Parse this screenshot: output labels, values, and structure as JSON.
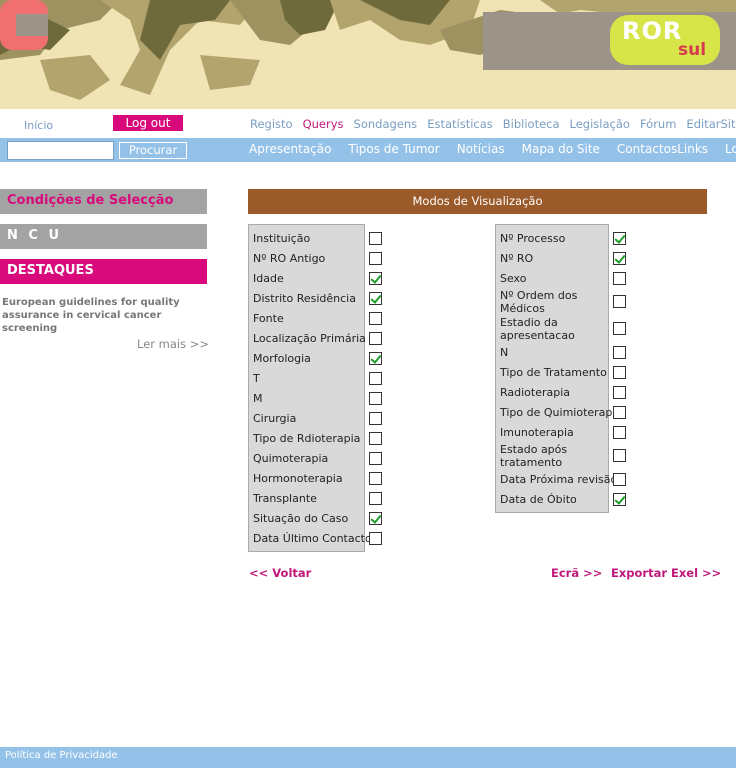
{
  "banner": {
    "logo_ror": "ROR",
    "logo_sul": "sul",
    "colors": {
      "sand": "#f1e4b4",
      "camo_dark": "#6e6a3c",
      "camo_mid": "#b3a46e",
      "logo_box": "#9c9488",
      "ror_bg": "#d8e548",
      "c_red": "#f07070"
    }
  },
  "topnav": {
    "inicio": "Início",
    "logout": "Log out",
    "items": [
      {
        "label": "Registo",
        "active": false
      },
      {
        "label": "Querys",
        "active": true
      },
      {
        "label": "Sondagens",
        "active": false
      },
      {
        "label": "Estatísticas",
        "active": false
      },
      {
        "label": "Biblioteca",
        "active": false
      },
      {
        "label": "Legislação",
        "active": false
      },
      {
        "label": "Fórum",
        "active": false
      },
      {
        "label": "EditarSite",
        "active": false
      }
    ]
  },
  "search": {
    "value": "",
    "button": "Procurar"
  },
  "subnav": [
    "Apresentação",
    "Tipos de Tumor",
    "Notícias",
    "Mapa do Site",
    "ContactosLinks",
    "Loja"
  ],
  "sidebar": {
    "conditions": "Condições de Selecção",
    "ncu": "N C U",
    "highlights": "DESTAQUES",
    "news_title": "European guidelines for quality assurance in cervical cancer screening",
    "read_more": "Ler mais >>"
  },
  "main": {
    "title": "Modos de Visualização",
    "left_options": [
      {
        "label": "Instituição",
        "checked": false
      },
      {
        "label": "Nº RO Antigo",
        "checked": false
      },
      {
        "label": "Idade",
        "checked": true
      },
      {
        "label": "Distrito Residência",
        "checked": true
      },
      {
        "label": "Fonte",
        "checked": false
      },
      {
        "label": "Localização Primária",
        "checked": false
      },
      {
        "label": "Morfologia",
        "checked": true
      },
      {
        "label": "T",
        "checked": false
      },
      {
        "label": "M",
        "checked": false
      },
      {
        "label": "Cirurgia",
        "checked": false
      },
      {
        "label": "Tipo de Rdioterapia",
        "checked": false
      },
      {
        "label": "Quimoterapia",
        "checked": false
      },
      {
        "label": "Hormonoterapia",
        "checked": false
      },
      {
        "label": "Transplante",
        "checked": false
      },
      {
        "label": "Situação do Caso",
        "checked": true
      },
      {
        "label": "Data Último Contacto",
        "checked": false
      }
    ],
    "right_options": [
      {
        "label": "Nº Processo",
        "checked": true
      },
      {
        "label": "Nº RO",
        "checked": true
      },
      {
        "label": "Sexo",
        "checked": false
      },
      {
        "label": "Nº Ordem dos Médicos",
        "checked": false
      },
      {
        "label": "Estadio da apresentacao",
        "checked": false
      },
      {
        "label": "N",
        "checked": false
      },
      {
        "label": "Tipo de Tratamento",
        "checked": false
      },
      {
        "label": "Radioterapia",
        "checked": false
      },
      {
        "label": "Tipo de Quimioterapia",
        "checked": false
      },
      {
        "label": "Imunoterapia",
        "checked": false
      },
      {
        "label": "Estado após tratamento",
        "checked": false
      },
      {
        "label": "Data Próxima revisão",
        "checked": false
      },
      {
        "label": "Data de Óbito",
        "checked": true
      }
    ],
    "back": "<< Voltar",
    "screen": "Ecrã >>",
    "export": "Exportar Exel >>"
  },
  "footer": {
    "privacy": "Política de Privacidade"
  }
}
